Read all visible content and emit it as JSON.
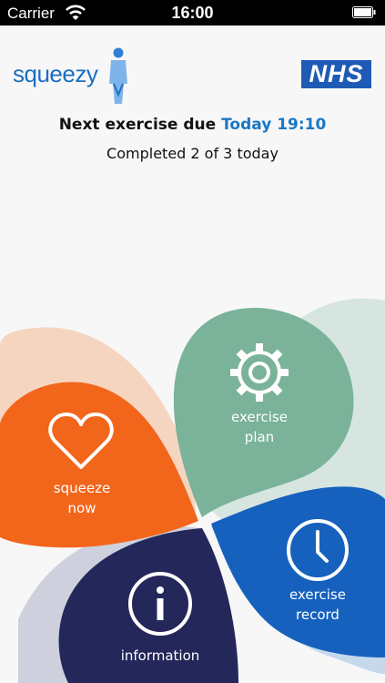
{
  "status": {
    "carrier": "Carrier",
    "time": "16:00"
  },
  "brand": {
    "app_name": "squeezy",
    "nhs": "NHS"
  },
  "schedule": {
    "next_label": "Next exercise due",
    "next_time": "Today 19:10",
    "completed": "Completed 2 of 3 today"
  },
  "menu": {
    "squeeze": {
      "line1": "squeeze",
      "line2": "now",
      "icon": "heart-icon",
      "color": "#f2661b"
    },
    "plan": {
      "line1": "exercise",
      "line2": "plan",
      "icon": "gear-icon",
      "color": "#7ab39a"
    },
    "record": {
      "line1": "exercise",
      "line2": "record",
      "icon": "clock-icon",
      "color": "#1561bd"
    },
    "info": {
      "line1": "information",
      "icon": "info-icon",
      "color": "#24275a"
    }
  }
}
